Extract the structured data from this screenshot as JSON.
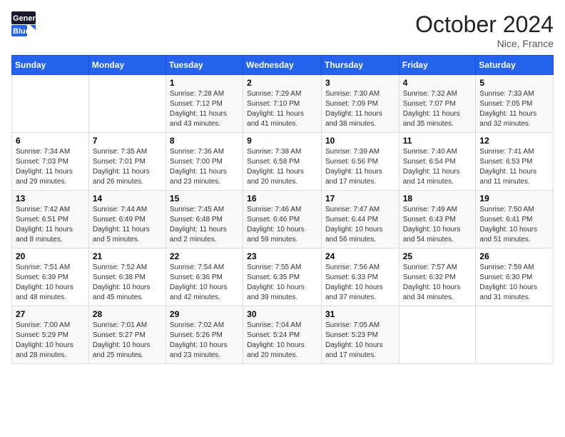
{
  "header": {
    "logo_general": "General",
    "logo_blue": "Blue",
    "month_title": "October 2024",
    "location": "Nice, France"
  },
  "weekdays": [
    "Sunday",
    "Monday",
    "Tuesday",
    "Wednesday",
    "Thursday",
    "Friday",
    "Saturday"
  ],
  "weeks": [
    [
      {
        "day": "",
        "sunrise": "",
        "sunset": "",
        "daylight": ""
      },
      {
        "day": "",
        "sunrise": "",
        "sunset": "",
        "daylight": ""
      },
      {
        "day": "1",
        "sunrise": "Sunrise: 7:28 AM",
        "sunset": "Sunset: 7:12 PM",
        "daylight": "Daylight: 11 hours and 43 minutes."
      },
      {
        "day": "2",
        "sunrise": "Sunrise: 7:29 AM",
        "sunset": "Sunset: 7:10 PM",
        "daylight": "Daylight: 11 hours and 41 minutes."
      },
      {
        "day": "3",
        "sunrise": "Sunrise: 7:30 AM",
        "sunset": "Sunset: 7:09 PM",
        "daylight": "Daylight: 11 hours and 38 minutes."
      },
      {
        "day": "4",
        "sunrise": "Sunrise: 7:32 AM",
        "sunset": "Sunset: 7:07 PM",
        "daylight": "Daylight: 11 hours and 35 minutes."
      },
      {
        "day": "5",
        "sunrise": "Sunrise: 7:33 AM",
        "sunset": "Sunset: 7:05 PM",
        "daylight": "Daylight: 11 hours and 32 minutes."
      }
    ],
    [
      {
        "day": "6",
        "sunrise": "Sunrise: 7:34 AM",
        "sunset": "Sunset: 7:03 PM",
        "daylight": "Daylight: 11 hours and 29 minutes."
      },
      {
        "day": "7",
        "sunrise": "Sunrise: 7:35 AM",
        "sunset": "Sunset: 7:01 PM",
        "daylight": "Daylight: 11 hours and 26 minutes."
      },
      {
        "day": "8",
        "sunrise": "Sunrise: 7:36 AM",
        "sunset": "Sunset: 7:00 PM",
        "daylight": "Daylight: 11 hours and 23 minutes."
      },
      {
        "day": "9",
        "sunrise": "Sunrise: 7:38 AM",
        "sunset": "Sunset: 6:58 PM",
        "daylight": "Daylight: 11 hours and 20 minutes."
      },
      {
        "day": "10",
        "sunrise": "Sunrise: 7:39 AM",
        "sunset": "Sunset: 6:56 PM",
        "daylight": "Daylight: 11 hours and 17 minutes."
      },
      {
        "day": "11",
        "sunrise": "Sunrise: 7:40 AM",
        "sunset": "Sunset: 6:54 PM",
        "daylight": "Daylight: 11 hours and 14 minutes."
      },
      {
        "day": "12",
        "sunrise": "Sunrise: 7:41 AM",
        "sunset": "Sunset: 6:53 PM",
        "daylight": "Daylight: 11 hours and 11 minutes."
      }
    ],
    [
      {
        "day": "13",
        "sunrise": "Sunrise: 7:42 AM",
        "sunset": "Sunset: 6:51 PM",
        "daylight": "Daylight: 11 hours and 8 minutes."
      },
      {
        "day": "14",
        "sunrise": "Sunrise: 7:44 AM",
        "sunset": "Sunset: 6:49 PM",
        "daylight": "Daylight: 11 hours and 5 minutes."
      },
      {
        "day": "15",
        "sunrise": "Sunrise: 7:45 AM",
        "sunset": "Sunset: 6:48 PM",
        "daylight": "Daylight: 11 hours and 2 minutes."
      },
      {
        "day": "16",
        "sunrise": "Sunrise: 7:46 AM",
        "sunset": "Sunset: 6:46 PM",
        "daylight": "Daylight: 10 hours and 59 minutes."
      },
      {
        "day": "17",
        "sunrise": "Sunrise: 7:47 AM",
        "sunset": "Sunset: 6:44 PM",
        "daylight": "Daylight: 10 hours and 56 minutes."
      },
      {
        "day": "18",
        "sunrise": "Sunrise: 7:49 AM",
        "sunset": "Sunset: 6:43 PM",
        "daylight": "Daylight: 10 hours and 54 minutes."
      },
      {
        "day": "19",
        "sunrise": "Sunrise: 7:50 AM",
        "sunset": "Sunset: 6:41 PM",
        "daylight": "Daylight: 10 hours and 51 minutes."
      }
    ],
    [
      {
        "day": "20",
        "sunrise": "Sunrise: 7:51 AM",
        "sunset": "Sunset: 6:39 PM",
        "daylight": "Daylight: 10 hours and 48 minutes."
      },
      {
        "day": "21",
        "sunrise": "Sunrise: 7:52 AM",
        "sunset": "Sunset: 6:38 PM",
        "daylight": "Daylight: 10 hours and 45 minutes."
      },
      {
        "day": "22",
        "sunrise": "Sunrise: 7:54 AM",
        "sunset": "Sunset: 6:36 PM",
        "daylight": "Daylight: 10 hours and 42 minutes."
      },
      {
        "day": "23",
        "sunrise": "Sunrise: 7:55 AM",
        "sunset": "Sunset: 6:35 PM",
        "daylight": "Daylight: 10 hours and 39 minutes."
      },
      {
        "day": "24",
        "sunrise": "Sunrise: 7:56 AM",
        "sunset": "Sunset: 6:33 PM",
        "daylight": "Daylight: 10 hours and 37 minutes."
      },
      {
        "day": "25",
        "sunrise": "Sunrise: 7:57 AM",
        "sunset": "Sunset: 6:32 PM",
        "daylight": "Daylight: 10 hours and 34 minutes."
      },
      {
        "day": "26",
        "sunrise": "Sunrise: 7:59 AM",
        "sunset": "Sunset: 6:30 PM",
        "daylight": "Daylight: 10 hours and 31 minutes."
      }
    ],
    [
      {
        "day": "27",
        "sunrise": "Sunrise: 7:00 AM",
        "sunset": "Sunset: 5:29 PM",
        "daylight": "Daylight: 10 hours and 28 minutes."
      },
      {
        "day": "28",
        "sunrise": "Sunrise: 7:01 AM",
        "sunset": "Sunset: 5:27 PM",
        "daylight": "Daylight: 10 hours and 25 minutes."
      },
      {
        "day": "29",
        "sunrise": "Sunrise: 7:02 AM",
        "sunset": "Sunset: 5:26 PM",
        "daylight": "Daylight: 10 hours and 23 minutes."
      },
      {
        "day": "30",
        "sunrise": "Sunrise: 7:04 AM",
        "sunset": "Sunset: 5:24 PM",
        "daylight": "Daylight: 10 hours and 20 minutes."
      },
      {
        "day": "31",
        "sunrise": "Sunrise: 7:05 AM",
        "sunset": "Sunset: 5:23 PM",
        "daylight": "Daylight: 10 hours and 17 minutes."
      },
      {
        "day": "",
        "sunrise": "",
        "sunset": "",
        "daylight": ""
      },
      {
        "day": "",
        "sunrise": "",
        "sunset": "",
        "daylight": ""
      }
    ]
  ]
}
